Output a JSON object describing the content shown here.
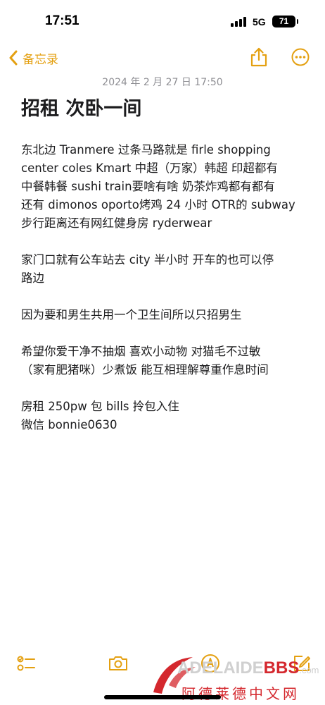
{
  "status_bar": {
    "time": "17:51",
    "network": "5G",
    "battery": "71"
  },
  "nav": {
    "back_label": "备忘录"
  },
  "note": {
    "date": "2024 年 2 月 27 日 17:50",
    "title": "招租 次卧一间",
    "paragraphs": [
      {
        "lines": [
          "东北边 Tranmere 过条马路就是 firle shopping",
          "center coles Kmart 中超（万家）韩超 印超都有",
          "中餐韩餐 sushi train要啥有啥 奶茶炸鸡都有都有",
          "还有 dimonos oporto烤鸡 24 小时 OTR的 subway",
          "步行距离还有网红健身房 ryderwear"
        ]
      },
      {
        "lines": [
          "家门口就有公车站去 city 半小时 开车的也可以停",
          "路边"
        ]
      },
      {
        "lines": [
          "因为要和男生共用一个卫生间所以只招男生"
        ]
      },
      {
        "lines": [
          "希望你爱干净不抽烟 喜欢小动物 对猫毛不过敏",
          "（家有肥猪咪）少煮饭 能互相理解尊重作息时间"
        ]
      },
      {
        "lines": [
          "房租 250pw 包 bills 拎包入住",
          "微信 bonnie0630"
        ]
      }
    ]
  },
  "watermark": {
    "brand_main": "ADELAIDE",
    "brand_bbs": "BBS",
    "brand_com": ".com",
    "cn": "阿德莱德中文网"
  },
  "colors": {
    "accent": "#e4a011",
    "text": "#1c1c1e",
    "secondary": "#8e8e93",
    "watermark_red": "#d4282e"
  },
  "icons": {
    "back": "chevron-left-icon",
    "share": "share-icon",
    "more": "ellipsis-circle-icon",
    "checklist": "checklist-icon",
    "camera": "camera-icon",
    "markup": "markup-pen-icon",
    "compose": "compose-icon"
  }
}
